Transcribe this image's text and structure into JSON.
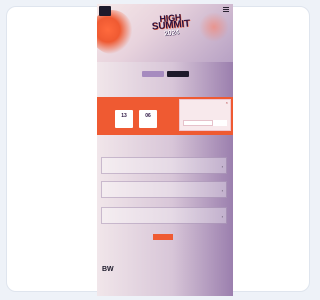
{
  "hero": {
    "logo": "",
    "title_line1": "HIGH",
    "title_line2": "SUMMIT",
    "title_line3": "2024"
  },
  "dates": {
    "label": "",
    "options": [
      "",
      ""
    ]
  },
  "countdown": {
    "title": "",
    "items": [
      {
        "num": "13",
        "unit": ""
      },
      {
        "num": "06",
        "unit": ""
      }
    ]
  },
  "popup": {
    "text": "",
    "button": ""
  },
  "events": {
    "heading": "",
    "cards": [
      {
        "name": "",
        "meta": ""
      },
      {
        "name": "",
        "meta": ""
      },
      {
        "name": "",
        "meta": ""
      }
    ]
  },
  "more_button": "",
  "footer": {
    "logo": "BW",
    "small": ""
  },
  "colors": {
    "accent": "#ef5a32",
    "dark": "#1d1a2b",
    "purple": "#a68bbf"
  }
}
